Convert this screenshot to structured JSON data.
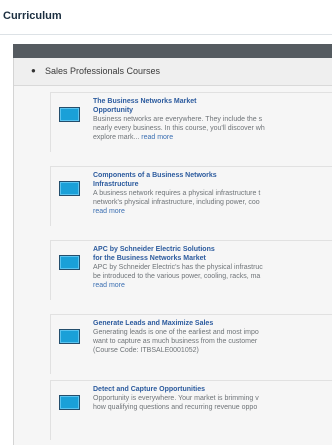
{
  "page": {
    "title": "Curriculum"
  },
  "section": {
    "label": "Sales Professionals Courses"
  },
  "courses": [
    {
      "title_line1": "The Business Networks Market",
      "title_line2": "Opportunity",
      "desc_line1": "Business networks are everywhere. They include the s",
      "desc_line2": "nearly every business. In this course, you'll discover wh",
      "desc_line3": "explore mark...",
      "read_more": "read more"
    },
    {
      "title_line1": "Components of a Business Networks",
      "title_line2": "Infrastructure",
      "desc_line1": "A business network requires a physical infrastructure t",
      "desc_line2": "network's physical infrastructure, including power, coo",
      "read_more": "read more"
    },
    {
      "title_line1": "APC by Schneider Electric Solutions",
      "title_line2": "for the Business Networks Market",
      "desc_line1": "APC by Schneider Electric's has the physical infrastruc",
      "desc_line2": "be introduced to the various power, cooling, racks, ma",
      "read_more": "read more"
    },
    {
      "title_line1": "Generate Leads and Maximize Sales",
      "desc_line1": "Generating leads is one of the earliest and most impo",
      "desc_line2": "want to capture as much business from the customer",
      "desc_line3": "(Course Code: ITBSALE0001052)"
    },
    {
      "title_line1": "Detect and Capture Opportunities",
      "desc_line1": "Opportunity is everywhere. Your market is brimming v",
      "desc_line2": "how qualifying questions and recurring revenue oppo"
    }
  ]
}
